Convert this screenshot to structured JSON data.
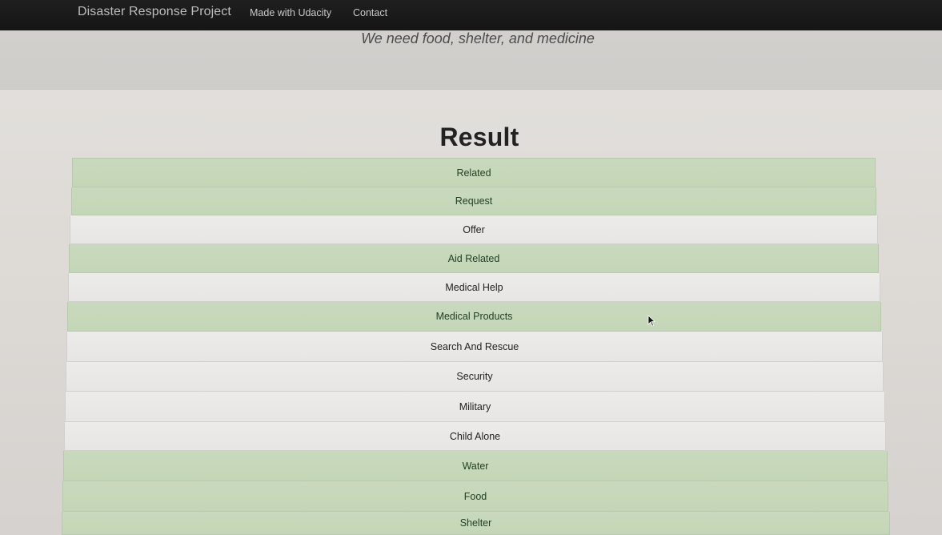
{
  "navbar": {
    "brand": "Disaster Response Project",
    "links": [
      {
        "label": "Made with Udacity"
      },
      {
        "label": "Contact"
      }
    ]
  },
  "jumbotron": {
    "message": "We need food, shelter, and medicine"
  },
  "result": {
    "title": "Result",
    "categories": [
      {
        "label": "Related",
        "active": true
      },
      {
        "label": "Request",
        "active": true
      },
      {
        "label": "Offer",
        "active": false
      },
      {
        "label": "Aid Related",
        "active": true
      },
      {
        "label": "Medical Help",
        "active": false
      },
      {
        "label": "Medical Products",
        "active": true
      },
      {
        "label": "Search And Rescue",
        "active": false
      },
      {
        "label": "Security",
        "active": false
      },
      {
        "label": "Military",
        "active": false
      },
      {
        "label": "Child Alone",
        "active": false
      },
      {
        "label": "Water",
        "active": true
      },
      {
        "label": "Food",
        "active": true
      },
      {
        "label": "Shelter",
        "active": true
      }
    ]
  },
  "colors": {
    "navbar_bg": "#1a1a1a",
    "active_row": "#c7d8bb",
    "inactive_row": "#e9e8e6",
    "page_bg": "#dddad7"
  }
}
